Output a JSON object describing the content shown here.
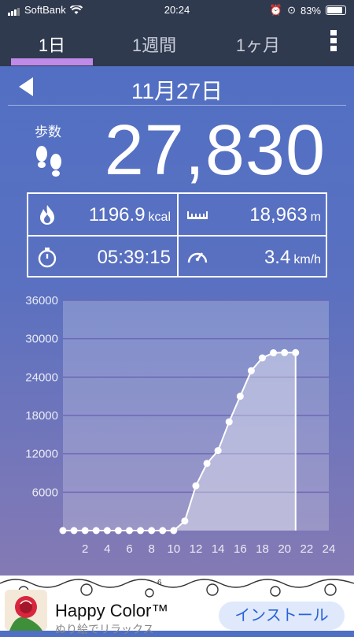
{
  "status_bar": {
    "carrier": "SoftBank",
    "time": "20:24",
    "battery": "83%"
  },
  "tabs": [
    {
      "label": "1日",
      "active": true
    },
    {
      "label": "1週間",
      "active": false
    },
    {
      "label": "1ヶ月",
      "active": false
    }
  ],
  "date": "11月27日",
  "steps": {
    "label": "歩数",
    "value": "27,830"
  },
  "stats": {
    "calories": {
      "value": "1196.9",
      "unit": "kcal"
    },
    "distance": {
      "value": "18,963",
      "unit": "m"
    },
    "duration": {
      "value": "05:39:15"
    },
    "speed": {
      "value": "3.4",
      "unit": "km/h"
    }
  },
  "chart_data": {
    "type": "area",
    "title": "",
    "xlabel": "",
    "ylabel": "",
    "xlim": [
      0,
      24
    ],
    "ylim": [
      0,
      36000
    ],
    "y_ticks": [
      6000,
      12000,
      18000,
      24000,
      30000,
      36000
    ],
    "x_ticks": [
      2,
      4,
      6,
      8,
      10,
      12,
      14,
      16,
      18,
      20,
      22,
      24
    ],
    "grid": true,
    "series": [
      {
        "x": [
          0,
          1,
          2,
          3,
          4,
          5,
          6,
          7,
          8,
          9,
          10,
          11,
          12,
          13,
          14,
          15,
          16,
          17,
          18,
          19,
          20,
          21
        ],
        "values": [
          0,
          0,
          0,
          0,
          0,
          0,
          0,
          0,
          0,
          0,
          0,
          1500,
          7000,
          10500,
          12500,
          17000,
          21000,
          25000,
          27000,
          27800,
          27830,
          27830
        ]
      }
    ],
    "colors": {
      "line": "#ffffff",
      "fill": "rgba(255,255,255,0.35)",
      "plot_bg": "rgba(255,255,255,0.22)",
      "grid": "#6f67b4"
    }
  },
  "ad": {
    "title": "Happy Color™",
    "subtitle": "ぬり絵でリラックス",
    "button": "インストール",
    "page_number": "6"
  }
}
